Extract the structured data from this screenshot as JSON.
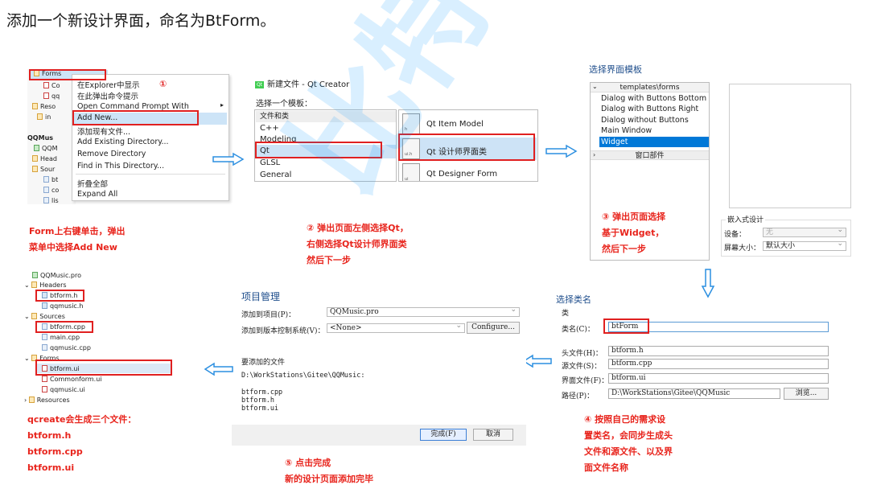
{
  "heading": "添加一个新设计界面，命名为BtForm。",
  "watermark": "比特就业课",
  "step1": {
    "tree": [
      "Forms",
      "Co",
      "qq",
      "Reso",
      "in",
      "QQMus",
      "QQM",
      "Head",
      "Sour",
      "bt",
      "co",
      "lis"
    ],
    "badge": "①",
    "menu": [
      "在Explorer中显示",
      "在此弹出命令提示",
      "Open Command Prompt With",
      "Add New...",
      "添加现有文件...",
      "Add Existing Directory...",
      "Remove Directory",
      "Find in This Directory...",
      "折叠全部",
      "Expand All"
    ],
    "submenu_arrow": "▸",
    "caption": [
      "Form上右键单击，弹出",
      "菜单中选择Add New"
    ]
  },
  "step2": {
    "window_title": "新建文件 - Qt Creator",
    "choose_label": "选择一个模板：",
    "categories_header": "文件和类",
    "categories": [
      "C++",
      "Modeling",
      "Qt",
      "GLSL",
      "General"
    ],
    "templates": [
      "Qt Item Model",
      "Qt 设计师界面类",
      "Qt Designer Form"
    ],
    "icon_labels": [
      "h",
      "ui.h",
      "ui"
    ],
    "caption": [
      "② 弹出页面左侧选择Qt，",
      "右侧选择Qt设计师界面类",
      "然后下一步"
    ]
  },
  "step3": {
    "title": "选择界面模板",
    "tree_header": "templates\\forms",
    "items": [
      "Dialog with Buttons Bottom",
      "Dialog with Buttons Right",
      "Dialog without Buttons",
      "Main Window",
      "Widget"
    ],
    "widgets_header": "窗口部件",
    "embed_title": "嵌入式设计",
    "device_label": "设备：",
    "device_value": "无",
    "screen_label": "屏幕大小：",
    "screen_value": "默认大小",
    "caption": [
      "③ 弹出页面选择",
      "基于Widget，",
      "然后下一步"
    ]
  },
  "step4": {
    "title": "选择类名",
    "group": "类",
    "class_label": "类名(C)：",
    "class_value": "btForm",
    "header_label": "头文件(H)：",
    "header_value": "btform.h",
    "source_label": "源文件(S)：",
    "source_value": "btform.cpp",
    "form_label": "界面文件(F)：",
    "form_value": "btform.ui",
    "path_label": "路径(P)：",
    "path_value": "D:\\WorkStations\\Gitee\\QQMusic",
    "browse": "浏览...",
    "caption": [
      "④ 按照自己的需求设",
      "置类名，会同步生成头",
      "文件和源文件、以及界",
      "面文件名称"
    ]
  },
  "step5": {
    "title": "项目管理",
    "add_to_label": "添加到项目(P)：",
    "add_to_value": "QQMusic.pro",
    "vcs_label": "添加到版本控制系统(V)：",
    "vcs_value": "<None>",
    "configure": "Configure...",
    "files_label": "要添加的文件",
    "dir": "D:\\WorkStations\\Gitee\\QQMusic:",
    "files": [
      "btform.cpp",
      "btform.h",
      "btform.ui"
    ],
    "finish": "完成(F)",
    "cancel": "取消",
    "caption": [
      "⑤ 点击完成",
      "新的设计页面添加完毕"
    ]
  },
  "result": {
    "tree": [
      "QQMusic.pro",
      "Headers",
      "btform.h",
      "qqmusic.h",
      "Sources",
      "btform.cpp",
      "main.cpp",
      "qqmusic.cpp",
      "Forms",
      "btform.ui",
      "Commonform.ui",
      "qqmusic.ui",
      "Resources"
    ],
    "caption": [
      "qcreate会生成三个文件：",
      "btform.h",
      "btform.cpp",
      "btform.ui"
    ]
  }
}
